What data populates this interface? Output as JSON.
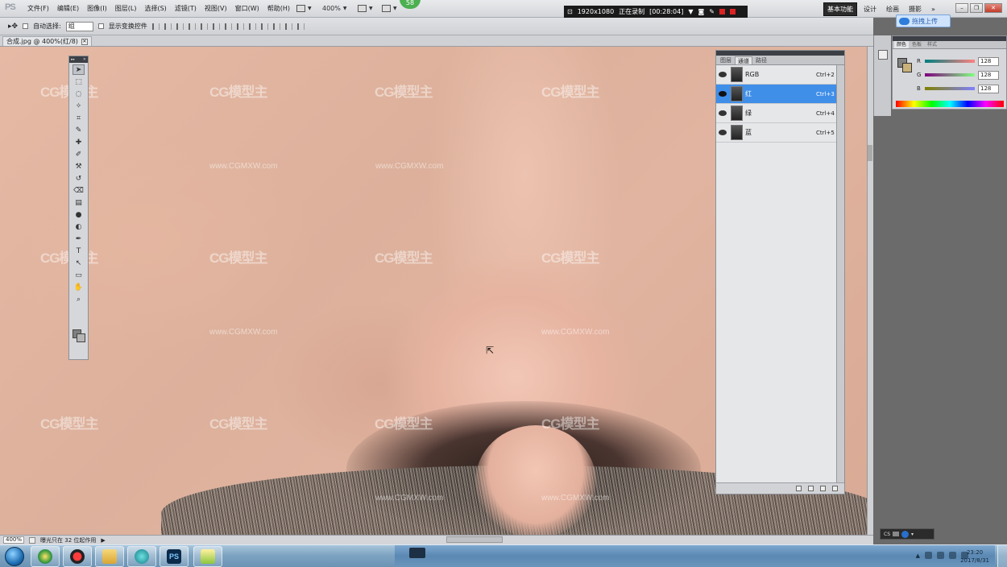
{
  "app": {
    "logo_text": "PS"
  },
  "menu": [
    "文件(F)",
    "编辑(E)",
    "图像(I)",
    "图层(L)",
    "选择(S)",
    "滤镜(T)",
    "视图(V)",
    "窗口(W)",
    "帮助(H)"
  ],
  "top_widgets": {
    "zoom": "400%",
    "badge": "58"
  },
  "recording": {
    "resolution": "1920x1080",
    "status": "正在录制",
    "time": "[00:28:04]"
  },
  "workspaces": {
    "items": [
      "基本功能",
      "设计",
      "绘画",
      "摄影",
      "»"
    ],
    "active": "基本功能"
  },
  "upload_button": "拖拽上传",
  "options_bar": {
    "auto_select_label": "自动选择:",
    "auto_select_value": "组",
    "show_transform_label": "显示变换控件"
  },
  "document": {
    "tab_label": "合成.jpg @ 400%(红/8)"
  },
  "watermark": {
    "brand": "CG模型主",
    "url": "www.CGMXW.com"
  },
  "tools": [
    "move-tool",
    "marquee-tool",
    "lasso-tool",
    "quick-select-tool",
    "crop-tool",
    "eyedropper-tool",
    "healing-brush-tool",
    "brush-tool",
    "clone-stamp-tool",
    "history-brush-tool",
    "eraser-tool",
    "gradient-tool",
    "blur-tool",
    "dodge-tool",
    "pen-tool",
    "type-tool",
    "path-select-tool",
    "shape-tool",
    "hand-tool",
    "zoom-tool"
  ],
  "tool_glyphs": [
    "➤",
    "⬚",
    "◌",
    "✧",
    "⌗",
    "✎",
    "✚",
    "✐",
    "⚒",
    "↺",
    "⌫",
    "▤",
    "●",
    "◐",
    "✒",
    "T",
    "↖",
    "▭",
    "✋",
    "⌕"
  ],
  "channels_panel": {
    "tabs": [
      "图层",
      "通道",
      "路径"
    ],
    "active_tab": "通道",
    "channels": [
      {
        "name": "RGB",
        "shortcut": "Ctrl+2",
        "selected": false
      },
      {
        "name": "红",
        "shortcut": "Ctrl+3",
        "selected": true
      },
      {
        "name": "绿",
        "shortcut": "Ctrl+4",
        "selected": false
      },
      {
        "name": "蓝",
        "shortcut": "Ctrl+5",
        "selected": false
      }
    ]
  },
  "color_panel": {
    "tabs": [
      "颜色",
      "色板",
      "样式"
    ],
    "active_tab": "颜色",
    "sliders": [
      {
        "label": "R",
        "value": "128"
      },
      {
        "label": "G",
        "value": "128"
      },
      {
        "label": "B",
        "value": "128"
      }
    ],
    "foreground": "#808080",
    "background": "#c9b27a"
  },
  "status_bar": {
    "zoom": "400%",
    "info": "曝光只在 32 位起作用"
  },
  "mini_panel": {
    "label": "CS"
  },
  "taskbar": {
    "time": "23:20",
    "date": "2017/8/31"
  }
}
